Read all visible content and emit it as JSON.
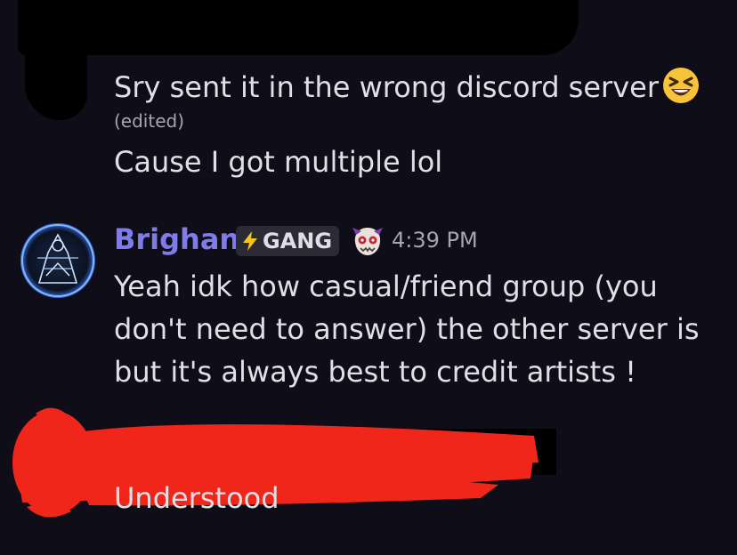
{
  "messages": [
    {
      "text": "Sry sent it in the wrong discord server",
      "emoji": "laughing-squint-emoji",
      "edited": "(edited)"
    },
    {
      "text": "Cause I got multiple lol"
    }
  ],
  "reply": {
    "username": "Brighan",
    "tag_label": "GANG",
    "tag_icon": "lightning-icon",
    "decoration_icon": "creature-badge-icon",
    "timestamp": "4:39 PM",
    "text": "Yeah idk how casual/friend group (you don't need to answer) the other server is but it's always best to credit artists !"
  },
  "last_message": {
    "text": "Understood"
  },
  "colors": {
    "background": "#0f0d18",
    "username": "#7f7bea",
    "text": "#dfe0e6",
    "muted": "#a3a6ae",
    "tag_bg": "#2b2a35",
    "redaction_red": "#f0261a"
  }
}
